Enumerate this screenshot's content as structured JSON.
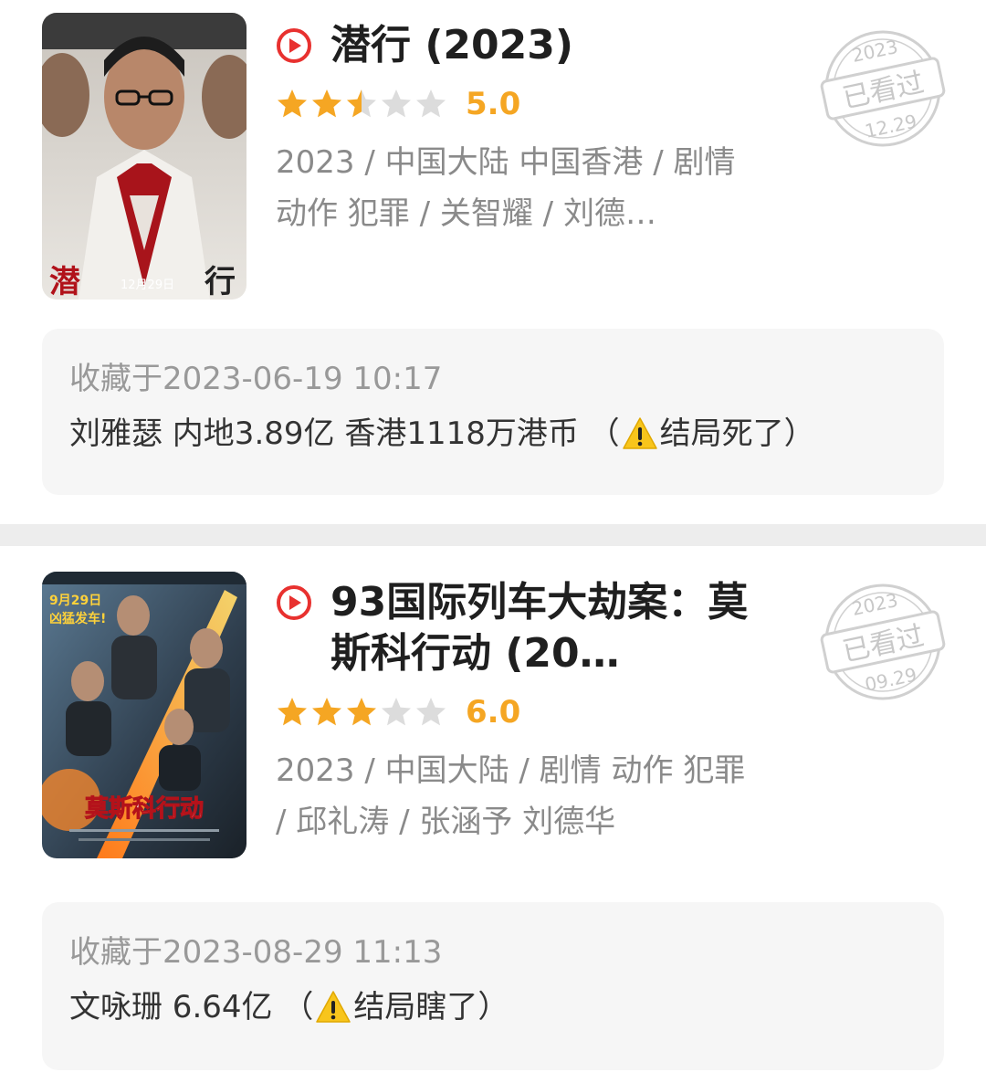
{
  "entries": [
    {
      "title": "潜行 (2023)",
      "rating_score": "5.0",
      "rating_fraction": 0.5,
      "meta": "2023 / 中国大陆 中国香港 / 剧情 动作 犯罪 / 关智耀 / 刘德…",
      "stamp": {
        "year": "2023",
        "label": "已看过",
        "date": "12.29"
      },
      "poster": {
        "title_left": "潜",
        "title_right": "行",
        "date_text": "12月29日"
      },
      "collected": "收藏于2023-06-19 10:17",
      "comment_before": "刘雅瑟 内地3.89亿 香港1118万港币 （",
      "comment_after": "结局死了）",
      "warn_icon": "warning-icon"
    },
    {
      "title": "93国际列车大劫案：莫斯科行动 (20…",
      "rating_score": "6.0",
      "rating_fraction": 0.6,
      "meta": "2023 / 中国大陆 / 剧情 动作 犯罪 / 邱礼涛 / 张涵予 刘德华",
      "stamp": {
        "year": "2023",
        "label": "已看过",
        "date": "09.29"
      },
      "poster": {
        "top_text": "9月29日",
        "top_text2": "凶猛发车!",
        "title": "莫斯科行动"
      },
      "collected": "收藏于2023-08-29 11:13",
      "comment_before": "文咏珊 6.64亿 （",
      "comment_after": "结局瞎了）",
      "warn_icon": "warning-icon"
    }
  ],
  "colors": {
    "star": "#f5a623",
    "play": "#e8312f",
    "stamp": "#d0d0d0",
    "note_bg": "#f6f6f6"
  }
}
